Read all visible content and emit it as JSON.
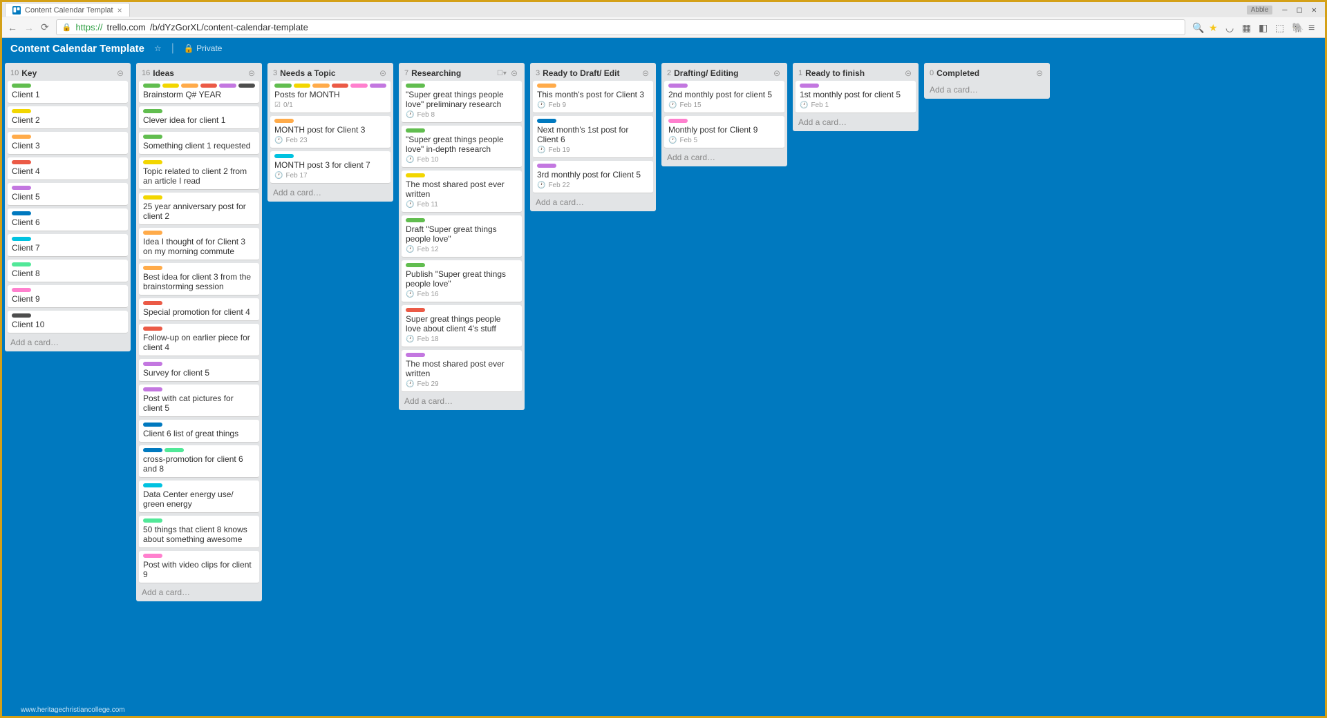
{
  "browser": {
    "tab_title": "Content Calendar Templat",
    "user": "Abble",
    "url_protocol": "https://",
    "url_host": "trello.com",
    "url_path": "/b/dYzGorXL/content-calendar-template"
  },
  "board": {
    "title": "Content Calendar Template",
    "visibility": "Private"
  },
  "add_card_label": "Add a card…",
  "lists": [
    {
      "count": 10,
      "title": "Key",
      "cards": [
        {
          "labels": [
            "green"
          ],
          "title": "Client 1"
        },
        {
          "labels": [
            "yellow"
          ],
          "title": "Client 2"
        },
        {
          "labels": [
            "orange"
          ],
          "title": "Client 3"
        },
        {
          "labels": [
            "red"
          ],
          "title": "Client 4"
        },
        {
          "labels": [
            "purple"
          ],
          "title": "Client 5"
        },
        {
          "labels": [
            "blue"
          ],
          "title": "Client 6"
        },
        {
          "labels": [
            "sky"
          ],
          "title": "Client 7"
        },
        {
          "labels": [
            "lime"
          ],
          "title": "Client 8"
        },
        {
          "labels": [
            "pink"
          ],
          "title": "Client 9"
        },
        {
          "labels": [
            "black"
          ],
          "title": "Client 10"
        }
      ]
    },
    {
      "count": 16,
      "title": "Ideas",
      "cards": [
        {
          "labels": [
            "green",
            "yellow",
            "orange",
            "red",
            "purple",
            "black"
          ],
          "title": "Brainstorm Q# YEAR"
        },
        {
          "labels": [
            "green"
          ],
          "title": "Clever idea for client 1"
        },
        {
          "labels": [
            "green"
          ],
          "title": "Something client 1 requested"
        },
        {
          "labels": [
            "yellow"
          ],
          "title": "Topic related to client 2 from an article I read"
        },
        {
          "labels": [
            "yellow"
          ],
          "title": "25 year anniversary post for client 2"
        },
        {
          "labels": [
            "orange"
          ],
          "title": "Idea I thought of for Client 3 on my morning commute"
        },
        {
          "labels": [
            "orange"
          ],
          "title": "Best idea for client 3 from the brainstorming session"
        },
        {
          "labels": [
            "red"
          ],
          "title": "Special promotion for client 4"
        },
        {
          "labels": [
            "red"
          ],
          "title": "Follow-up on earlier piece for client 4"
        },
        {
          "labels": [
            "purple"
          ],
          "title": "Survey for client 5"
        },
        {
          "labels": [
            "purple"
          ],
          "title": "Post with cat pictures for client 5"
        },
        {
          "labels": [
            "blue"
          ],
          "title": "Client 6 list of great things"
        },
        {
          "labels": [
            "blue",
            "lime"
          ],
          "title": "cross-promotion for client 6 and 8"
        },
        {
          "labels": [
            "sky"
          ],
          "title": "Data Center energy use/ green energy"
        },
        {
          "labels": [
            "lime"
          ],
          "title": "50 things that client 8 knows about something awesome"
        },
        {
          "labels": [
            "pink"
          ],
          "title": "Post with video clips for client 9"
        }
      ]
    },
    {
      "count": 3,
      "title": "Needs a Topic",
      "cards": [
        {
          "labels": [
            "green",
            "yellow",
            "orange",
            "red",
            "pink",
            "purple"
          ],
          "title": "Posts for MONTH",
          "checklist": "0/1"
        },
        {
          "labels": [
            "orange"
          ],
          "title": "MONTH post for Client 3",
          "due": "Feb  23"
        },
        {
          "labels": [
            "sky"
          ],
          "title": "MONTH post 3 for client 7",
          "due": "Feb  17"
        }
      ]
    },
    {
      "count": 7,
      "title": "Researching",
      "extra": "☐▾",
      "cards": [
        {
          "labels": [
            "green"
          ],
          "title": "\"Super great things people love\" preliminary research",
          "due": "Feb  8"
        },
        {
          "labels": [
            "green"
          ],
          "title": "\"Super great things people love\" in-depth research",
          "due": "Feb  10"
        },
        {
          "labels": [
            "yellow"
          ],
          "title": "The most shared post ever written",
          "due": "Feb  11"
        },
        {
          "labels": [
            "green"
          ],
          "title": "Draft \"Super great things people love\"",
          "due": "Feb  12"
        },
        {
          "labels": [
            "green"
          ],
          "title": "Publish \"Super great things people love\"",
          "due": "Feb  16"
        },
        {
          "labels": [
            "red"
          ],
          "title": "Super great things people love about client 4's stuff",
          "due": "Feb  18"
        },
        {
          "labels": [
            "purple"
          ],
          "title": "The most shared post ever written",
          "due": "Feb  29"
        }
      ]
    },
    {
      "count": 3,
      "title": "Ready to Draft/ Edit",
      "cards": [
        {
          "labels": [
            "orange"
          ],
          "title": "This month's post for Client 3",
          "due": "Feb  9"
        },
        {
          "labels": [
            "blue"
          ],
          "title": "Next month's 1st post for Client 6",
          "due": "Feb  19"
        },
        {
          "labels": [
            "purple"
          ],
          "title": "3rd monthly post for Client 5",
          "due": "Feb  22"
        }
      ]
    },
    {
      "count": 2,
      "title": "Drafting/ Editing",
      "cards": [
        {
          "labels": [
            "purple"
          ],
          "title": "2nd monthly post for client 5",
          "due": "Feb  15"
        },
        {
          "labels": [
            "pink"
          ],
          "title": "Monthly post for Client 9",
          "due": "Feb  5"
        }
      ]
    },
    {
      "count": 1,
      "title": "Ready to finish",
      "cards": [
        {
          "labels": [
            "purple"
          ],
          "title": "1st monthly post for client 5",
          "due": "Feb  1"
        }
      ]
    },
    {
      "count": 0,
      "title": "Completed",
      "cards": []
    }
  ],
  "watermark": "www.heritagechristiancollege.com"
}
